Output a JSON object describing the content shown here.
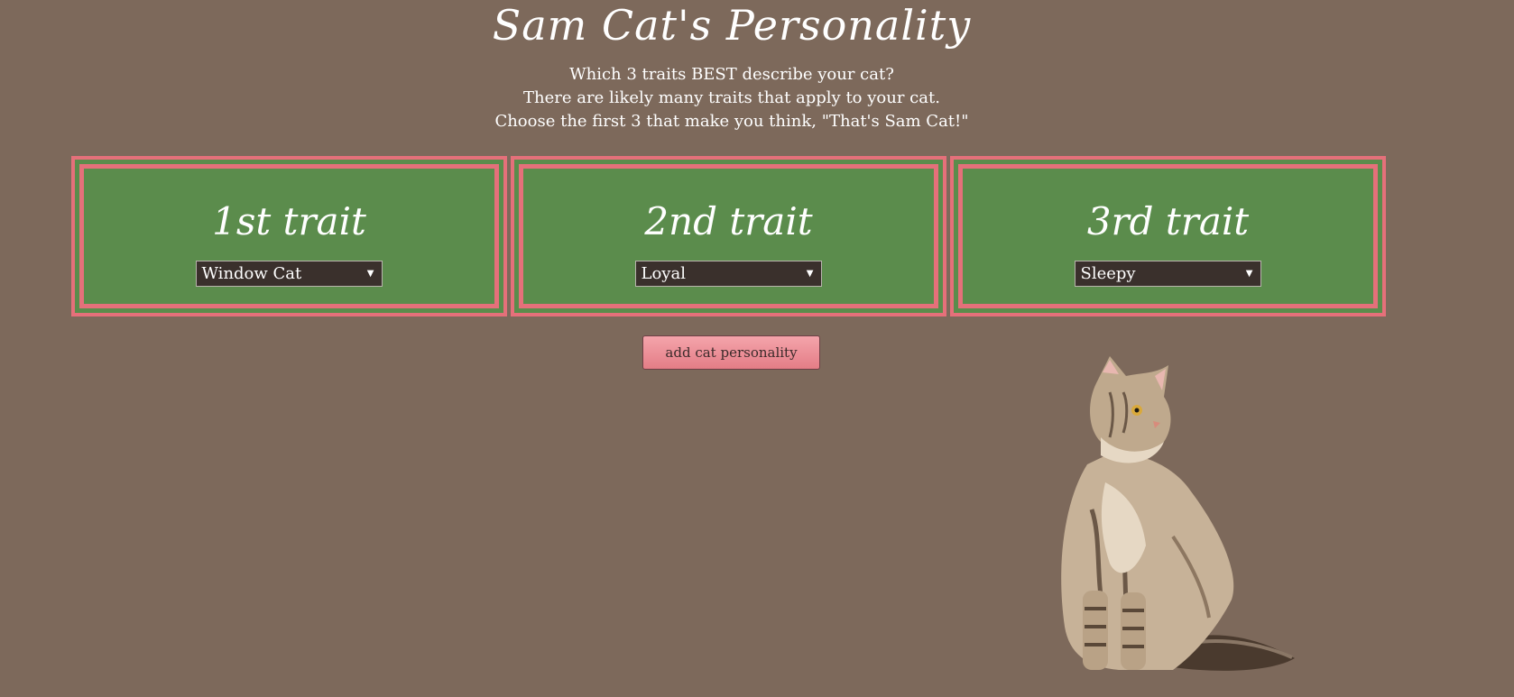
{
  "page": {
    "title": "Sam Cat's Personality",
    "intro_lines": [
      "Which 3 traits BEST describe your cat?",
      "There are likely many traits that apply to your cat.",
      "Choose the first 3 that make you think, \"That's Sam Cat!\""
    ]
  },
  "traits": [
    {
      "heading": "1st trait",
      "selected": "Window Cat"
    },
    {
      "heading": "2nd trait",
      "selected": "Loyal"
    },
    {
      "heading": "3rd trait",
      "selected": "Sleepy"
    }
  ],
  "actions": {
    "add_label": "add cat personality"
  },
  "icons": {
    "dropdown": "caret-down-icon",
    "cat_image": "cat-photo"
  },
  "colors": {
    "background": "#7d695b",
    "panel": "#5b8c4c",
    "border": "#e5707a",
    "select_bg": "#3a302c",
    "button": "#f0959d"
  }
}
